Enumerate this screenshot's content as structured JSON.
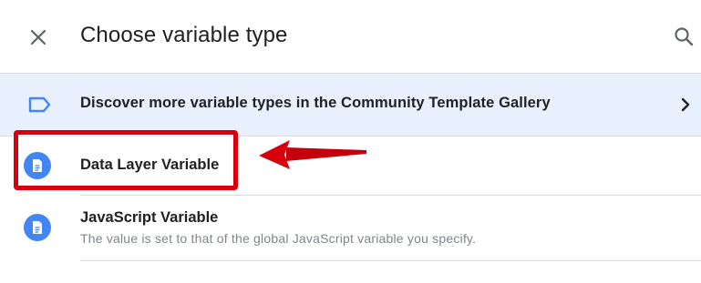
{
  "header": {
    "title": "Choose variable type",
    "close_icon": "close-icon",
    "search_icon": "search-icon"
  },
  "banner": {
    "icon": "tag-icon",
    "text": "Discover more variable types in the Community Template Gallery",
    "chevron_icon": "chevron-right-icon"
  },
  "variable_types": [
    {
      "icon": "document-icon",
      "title": "Data Layer Variable",
      "description": ""
    },
    {
      "icon": "document-icon",
      "title": "JavaScript Variable",
      "description": "The value is set to that of the global JavaScript variable you specify."
    }
  ],
  "colors": {
    "accent": "#4285f4",
    "banner_bg": "#e8f0fe",
    "annotation_red": "#d9000d",
    "text_primary": "#202124",
    "text_secondary": "#80868b",
    "divider": "#dadce0"
  }
}
